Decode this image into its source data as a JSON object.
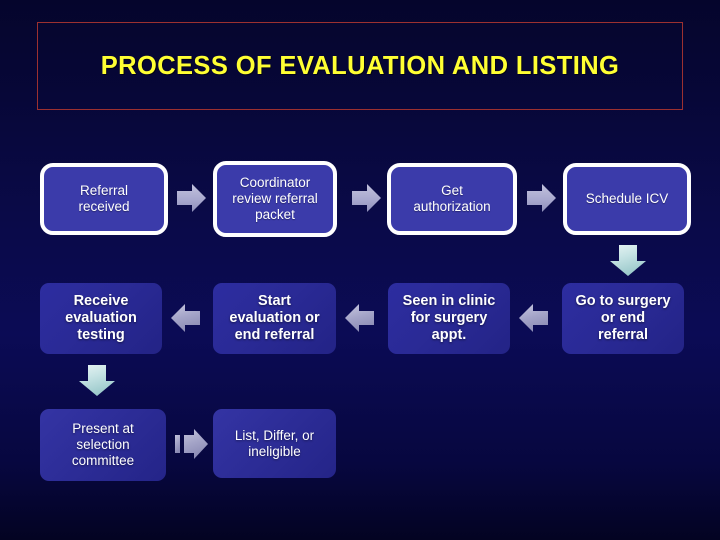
{
  "slide": {
    "title": "PROCESS OF EVALUATION AND LISTING",
    "background_color": "#000055",
    "title_color": "#ffff33",
    "title_border_color": "#9c3030",
    "box_fill_color": "#3b3baa",
    "box_border_color": "#ffffff",
    "arrow_color": "#a9a9cf",
    "down_arrow_color": "#bfe4e4",
    "text_color": "#ffffff"
  },
  "flow": {
    "row1": [
      {
        "id": "referral-received",
        "label": "Referral\nreceived"
      },
      {
        "id": "coordinator-review",
        "label": "Coordinator\nreview referral\npacket"
      },
      {
        "id": "get-authorization",
        "label": "Get\nauthorization"
      },
      {
        "id": "schedule-icv",
        "label": "Schedule ICV"
      }
    ],
    "row2": [
      {
        "id": "receive-evaluation-testing",
        "label": "Receive\nevaluation\ntesting"
      },
      {
        "id": "start-evaluation",
        "label": "Start\nevaluation or\nend referral"
      },
      {
        "id": "seen-in-clinic",
        "label": "Seen in clinic\nfor surgery\nappt."
      },
      {
        "id": "go-to-surgery",
        "label": "Go to surgery\nor end\nreferral"
      }
    ],
    "row3": [
      {
        "id": "present-at-committee",
        "label": "Present at\nselection\ncommittee"
      },
      {
        "id": "list-differ",
        "label": "List, Differ, or\nineligible"
      }
    ],
    "connectors": [
      {
        "id": "arrow-referral-to-coordinator",
        "direction": "right"
      },
      {
        "id": "arrow-coordinator-to-auth",
        "direction": "right"
      },
      {
        "id": "arrow-auth-to-icv",
        "direction": "right"
      },
      {
        "id": "arrow-icv-to-surgery",
        "direction": "down"
      },
      {
        "id": "arrow-surgery-to-clinic",
        "direction": "left"
      },
      {
        "id": "arrow-clinic-to-start",
        "direction": "left"
      },
      {
        "id": "arrow-start-to-receive",
        "direction": "left"
      },
      {
        "id": "arrow-receive-to-present",
        "direction": "down"
      },
      {
        "id": "arrow-present-to-list",
        "direction": "right"
      }
    ]
  }
}
